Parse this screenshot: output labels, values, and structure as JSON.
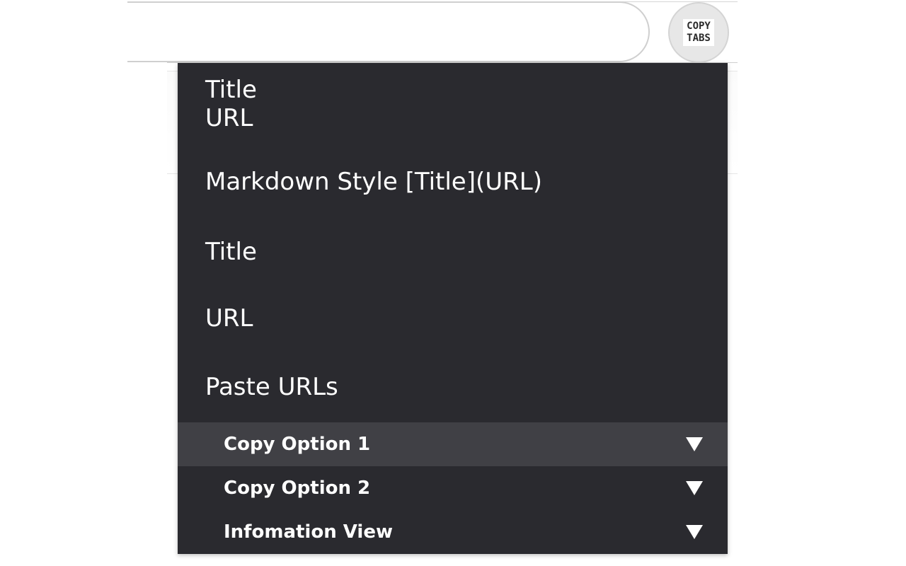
{
  "extension": {
    "logo_line1": "COPY",
    "logo_line2": "TABS",
    "icon": "copy-tabs-logo-icon"
  },
  "menu": {
    "items": [
      {
        "lines": [
          "Title",
          "URL"
        ]
      },
      {
        "lines": [
          "Markdown Style [Title](URL)"
        ]
      },
      {
        "lines": [
          "Title"
        ]
      },
      {
        "lines": [
          "URL"
        ]
      },
      {
        "lines": [
          "Paste URLs"
        ]
      }
    ]
  },
  "sections": [
    {
      "label": "Copy Option 1",
      "icon": "caret-down-icon"
    },
    {
      "label": "Copy Option 2",
      "icon": "caret-down-icon"
    },
    {
      "label": "Infomation View",
      "icon": "caret-down-icon"
    }
  ],
  "colors": {
    "popup_bg": "#2a2a2f",
    "active_row_bg": "#404045",
    "text": "#ffffff"
  }
}
